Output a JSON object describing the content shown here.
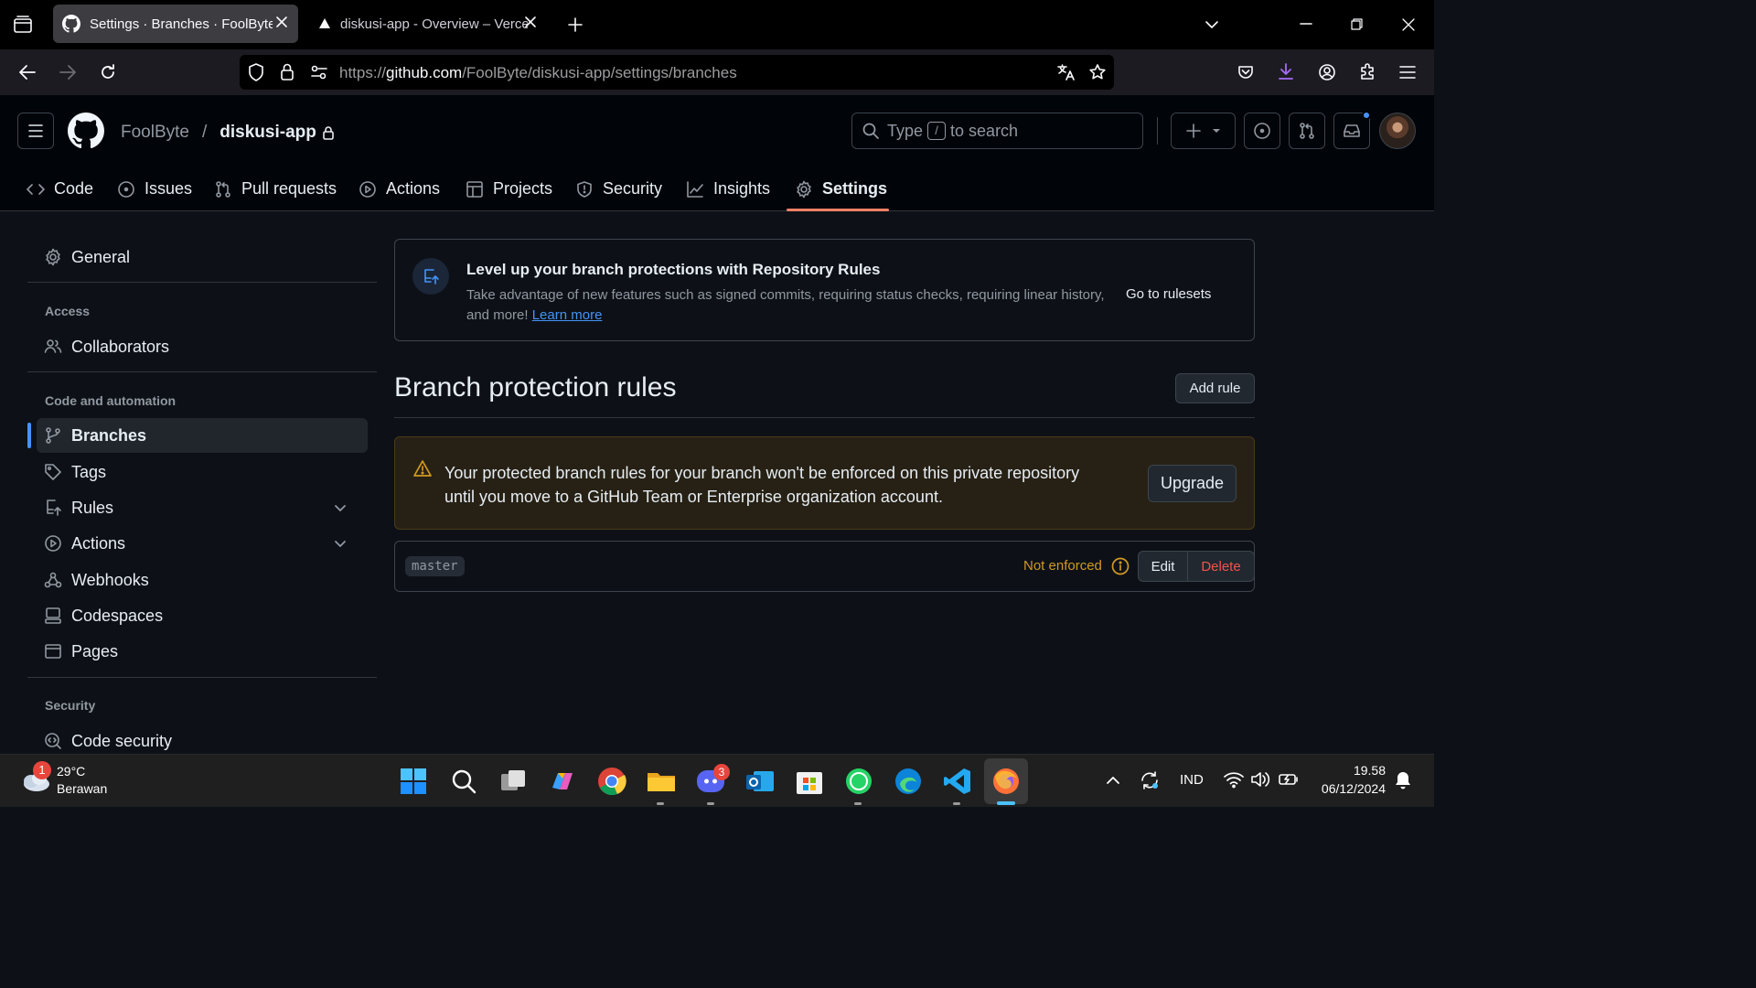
{
  "browser": {
    "tabs": [
      {
        "title": "Settings · Branches · FoolByte/diskusi-app",
        "active": true
      },
      {
        "title": "diskusi-app - Overview – Vercel",
        "active": false
      }
    ],
    "url_prefix": "https://",
    "url_host": "github.com",
    "url_path": "/FoolByte/diskusi-app/settings/branches"
  },
  "github_header": {
    "owner": "FoolByte",
    "separator": "/",
    "repo": "diskusi-app",
    "search_prefix": "Type",
    "search_key": "/",
    "search_suffix": "to search"
  },
  "repo_tabs": [
    {
      "label": "Code",
      "icon": "code-icon"
    },
    {
      "label": "Issues",
      "icon": "issue-icon"
    },
    {
      "label": "Pull requests",
      "icon": "pull-request-icon"
    },
    {
      "label": "Actions",
      "icon": "play-icon"
    },
    {
      "label": "Projects",
      "icon": "table-icon"
    },
    {
      "label": "Security",
      "icon": "shield-icon"
    },
    {
      "label": "Insights",
      "icon": "graph-icon"
    },
    {
      "label": "Settings",
      "icon": "gear-icon",
      "selected": true
    }
  ],
  "sidebar": {
    "general": "General",
    "access_heading": "Access",
    "collaborators": "Collaborators",
    "code_heading": "Code and automation",
    "branches": "Branches",
    "tags": "Tags",
    "rules": "Rules",
    "actions": "Actions",
    "webhooks": "Webhooks",
    "codespaces": "Codespaces",
    "pages": "Pages",
    "security_heading": "Security",
    "code_security": "Code security"
  },
  "banner": {
    "title": "Level up your branch protections with Repository Rules",
    "body": "Take advantage of new features such as signed commits, requiring status checks, requiring linear history, and more!",
    "learn_more": "Learn more",
    "action": "Go to rulesets"
  },
  "main": {
    "heading": "Branch protection rules",
    "add_rule": "Add rule"
  },
  "warning": {
    "text": "Your protected branch rules for your branch won't be enforced on this private repository until you move to a GitHub Team or Enterprise organization account.",
    "upgrade": "Upgrade"
  },
  "rule": {
    "branch": "master",
    "status": "Not enforced",
    "edit": "Edit",
    "delete": "Delete"
  },
  "taskbar": {
    "weather_badge": "1",
    "temperature": "29°C",
    "condition": "Berawan",
    "discord_badge": "3",
    "language": "IND",
    "time": "19.58",
    "date": "06/12/2024"
  },
  "colors": {
    "accent_tab_underline": "#f78166",
    "selected_indicator": "#4493f8",
    "warning": "#d29922",
    "danger": "#f85149",
    "link": "#4493f8"
  }
}
